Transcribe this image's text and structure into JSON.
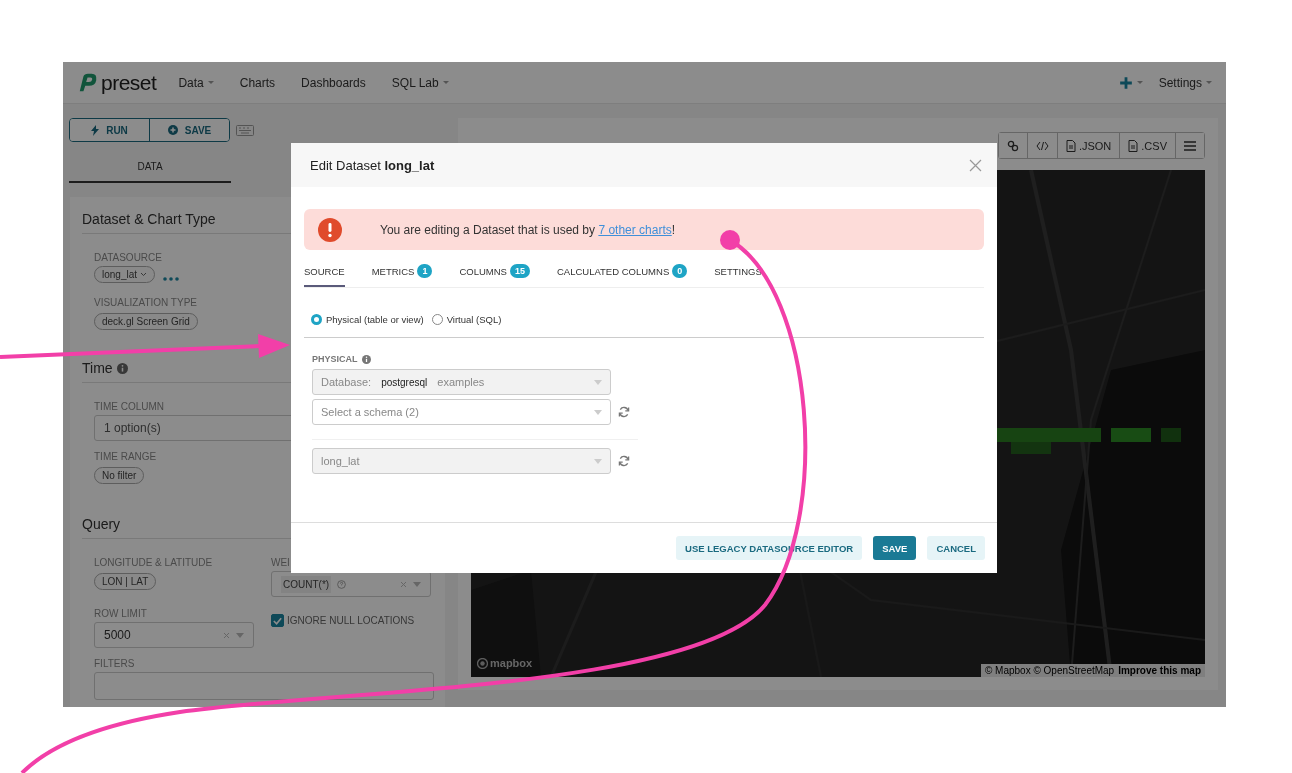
{
  "header": {
    "logo": "preset",
    "nav": [
      {
        "label": "Data",
        "dropdown": true
      },
      {
        "label": "Charts",
        "dropdown": false
      },
      {
        "label": "Dashboards",
        "dropdown": false
      },
      {
        "label": "SQL Lab",
        "dropdown": true
      }
    ],
    "settings": {
      "label": "Settings",
      "dropdown": true
    }
  },
  "controls": {
    "run": "RUN",
    "save": "SAVE",
    "tabs": [
      {
        "label": "DATA",
        "selected": true
      }
    ]
  },
  "panel": {
    "dataset_section": {
      "title": "Dataset & Chart Type",
      "datasource_label": "DATASOURCE",
      "datasource": "long_lat",
      "viz_label": "VISUALIZATION TYPE",
      "viz": "deck.gl Screen Grid"
    },
    "time_section": {
      "title": "Time",
      "time_column_label": "TIME COLUMN",
      "time_column_placeholder": "1 option(s)",
      "time_range_label": "TIME RANGE",
      "time_range": "No filter"
    },
    "query_section": {
      "title": "Query",
      "lonlat_label": "LONGITUDE & LATITUDE",
      "lonlat": "LON | LAT",
      "weight_label": "WEI",
      "weight": "COUNT(*)",
      "row_limit_label": "ROW LIMIT",
      "row_limit": "5000",
      "ignore_null": {
        "label": "IGNORE NULL LOCATIONS",
        "checked": true
      },
      "filters_label": "FILTERS"
    }
  },
  "chart": {
    "toolbar": [
      {
        "kind": "link"
      },
      {
        "kind": "code"
      },
      {
        "kind": "file",
        "label": ".JSON"
      },
      {
        "kind": "file",
        "label": ".CSV"
      },
      {
        "kind": "menu"
      }
    ],
    "map": {
      "logo": "mapbox",
      "attribution": "© Mapbox © OpenStreetMap",
      "improve": "Improve this map"
    }
  },
  "modal": {
    "title": "Edit Dataset **long_lat**",
    "alert": {
      "text": "You are editing a Dataset that is used by ",
      "link": "7 other charts",
      "end": "!"
    },
    "tabs": [
      {
        "label": "SOURCE",
        "selected": true
      },
      {
        "label": "METRICS",
        "count": "1",
        "selected": false
      },
      {
        "label": "COLUMNS",
        "count": "15",
        "selected": false
      },
      {
        "label": "CALCULATED COLUMNS",
        "count": "0",
        "selected": false
      },
      {
        "label": "SETTINGS",
        "selected": false
      }
    ],
    "source_types": [
      {
        "label": "Physical (table or view)",
        "selected": true
      },
      {
        "label": "Virtual (SQL)",
        "selected": false
      }
    ],
    "physical": {
      "label": "PHYSICAL",
      "database_label": "Database:",
      "database_backend": "postgresql",
      "database": "examples",
      "schema_placeholder": "Select a schema (2)",
      "table": "long_lat"
    },
    "buttons": [
      {
        "label": "USE LEGACY DATASOURCE EDITOR",
        "kind": "secondary"
      },
      {
        "label": "SAVE",
        "kind": "primary"
      },
      {
        "label": "CANCEL",
        "kind": "secondary"
      }
    ]
  }
}
